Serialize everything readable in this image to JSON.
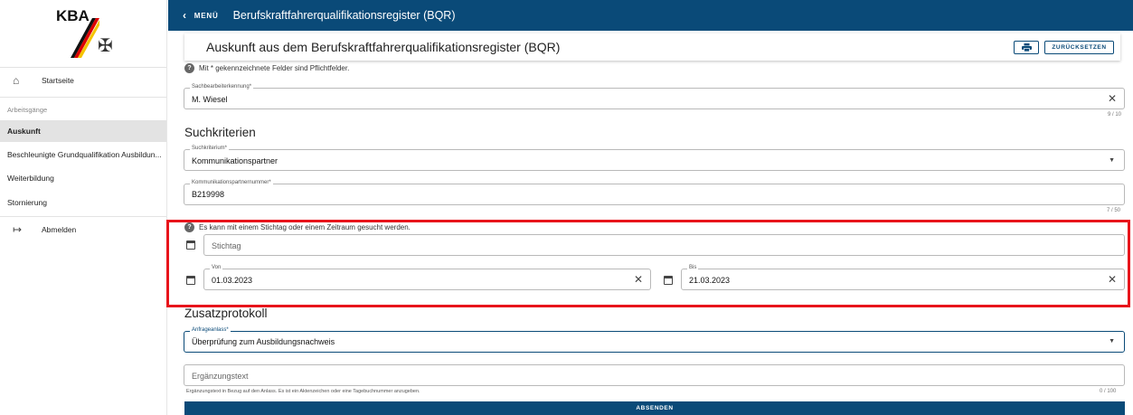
{
  "sidebar": {
    "logo_text": "KBA",
    "items": [
      {
        "label": "Startseite",
        "icon": "home-icon"
      },
      {
        "section": "Arbeitsgänge"
      },
      {
        "label": "Auskunft",
        "active": true
      },
      {
        "label": "Beschleunigte Grundqualifikation Ausbildun..."
      },
      {
        "label": "Weiterbildung"
      },
      {
        "label": "Stornierung"
      },
      {
        "label": "Abmelden",
        "icon": "logout-icon"
      }
    ]
  },
  "topbar": {
    "menu_label": "MENÜ",
    "title": "Berufskraftfahrerqualifikationsregister (BQR)"
  },
  "header": {
    "title": "Auskunft aus dem Berufskraftfahrerqualifikationsregister (BQR)",
    "reset_label": "ZURÜCKSETZEN"
  },
  "form": {
    "required_hint": "Mit * gekennzeichnete Felder sind Pflichtfelder.",
    "sachbearbeiter": {
      "label": "Sachbearbeiterkennung*",
      "value": "M. Wiesel",
      "counter": "9 / 10"
    },
    "suchkriterien_title": "Suchkriterien",
    "suchkriterium": {
      "label": "Suchkriterium*",
      "value": "Kommunikationspartner"
    },
    "kommunikationspartner": {
      "label": "Kommunikationspartnernummer*",
      "value": "B219998",
      "counter": "7 / 50"
    },
    "date_hint": "Es kann mit einem Stichtag oder einem Zeitraum gesucht werden.",
    "stichtag": {
      "placeholder": "Stichtag"
    },
    "von": {
      "label": "Von",
      "value": "01.03.2023"
    },
    "bis": {
      "label": "Bis",
      "value": "21.03.2023"
    },
    "zusatzprotokoll_title": "Zusatzprotokoll",
    "anfrageanlass": {
      "label": "Anfrageanlass*",
      "value": "Überprüfung zum Ausbildungsnachweis"
    },
    "ergaenzung": {
      "placeholder": "Ergänzungstext",
      "helper": "Ergänzungstext in Bezug auf den Anlass. Es ist ein Aktenzeichen oder eine Tagebuchnummer anzugeben.",
      "counter": "0 / 100"
    },
    "submit_label": "ABSENDEN"
  },
  "colors": {
    "primary": "#0a4a78",
    "highlight": "#e8141b"
  }
}
